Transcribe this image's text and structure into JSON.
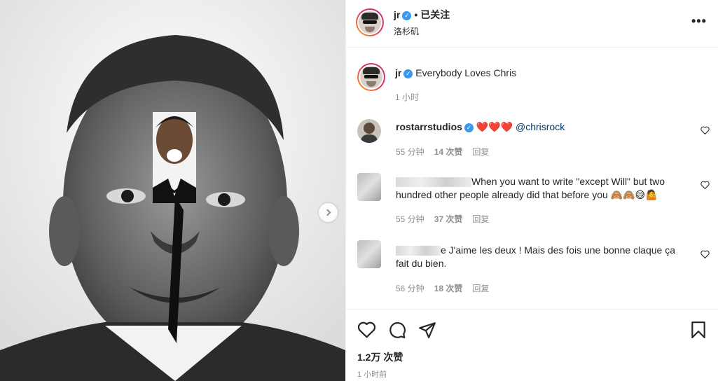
{
  "post": {
    "username": "jr",
    "follow_status": "已关注",
    "location": "洛杉矶",
    "caption": "Everybody Loves Chris",
    "caption_time": "1 小时",
    "likes_total": "1.2万 次赞",
    "posted_time": "1 小时前"
  },
  "comments": [
    {
      "username": "rostarrstudios",
      "text": "❤️❤️❤️",
      "mention": "@chrisrock",
      "time": "55 分钟",
      "likes": "14 次赞",
      "reply": "回复"
    },
    {
      "username": "",
      "text": "When you want to write \"except Will\" but two hundred other people already did that before you 🙈🙈😅🤷",
      "time": "55 分钟",
      "likes": "37 次赞",
      "reply": "回复"
    },
    {
      "username": "",
      "text": "e J'aime les deux ! Mais des fois une bonne claque ça fait du bien.",
      "time": "56 分钟",
      "likes": "18 次赞",
      "reply": "回复"
    }
  ],
  "icons": {
    "more": "more-options-icon",
    "like": "heart-icon",
    "comment": "comment-icon",
    "share": "share-icon",
    "save": "bookmark-icon",
    "next": "chevron-right-icon"
  },
  "colors": {
    "verified": "#3897f0",
    "mention": "#00376b",
    "muted": "#8e8e8e"
  }
}
